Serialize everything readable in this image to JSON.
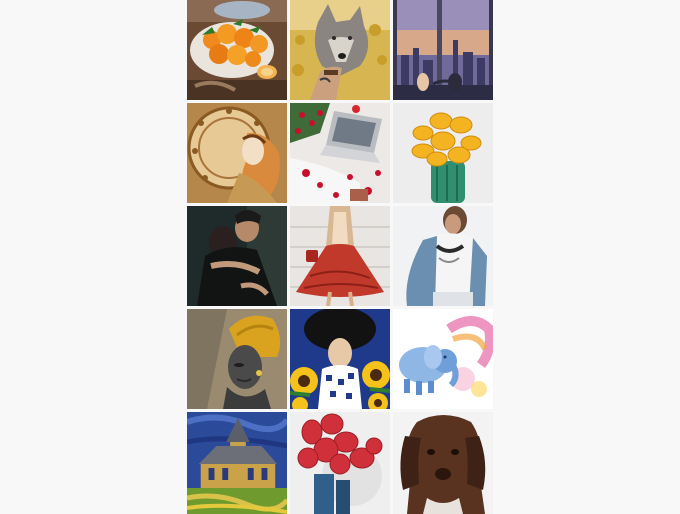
{
  "gallery": {
    "tiles": [
      {
        "subject": "oranges-in-bowl",
        "accent": "#f08a1c"
      },
      {
        "subject": "hand-holding-wolf",
        "accent": "#d9b24a"
      },
      {
        "subject": "window-city-view",
        "accent": "#3b3f6e"
      },
      {
        "subject": "art-nouveau-zodiac-woman",
        "accent": "#c8913e"
      },
      {
        "subject": "laptop-and-berries",
        "accent": "#c8102e"
      },
      {
        "subject": "yellow-flowering-cactus",
        "accent": "#f4b320"
      },
      {
        "subject": "embracing-couple",
        "accent": "#2a2f2a"
      },
      {
        "subject": "woman-in-red-skirt",
        "accent": "#c0392b"
      },
      {
        "subject": "woman-in-denim-jacket",
        "accent": "#6b8fb1"
      },
      {
        "subject": "woman-with-yellow-turban",
        "accent": "#d9a21f"
      },
      {
        "subject": "woman-with-sunflowers",
        "accent": "#1f3a8a"
      },
      {
        "subject": "watercolor-elephants",
        "accent": "#5b9bd5"
      },
      {
        "subject": "church-at-auvers",
        "accent": "#2c4a9a"
      },
      {
        "subject": "red-cactus-blue-vase",
        "accent": "#d0303a"
      },
      {
        "subject": "brown-spaniel-dog",
        "accent": "#5a3320"
      }
    ]
  }
}
